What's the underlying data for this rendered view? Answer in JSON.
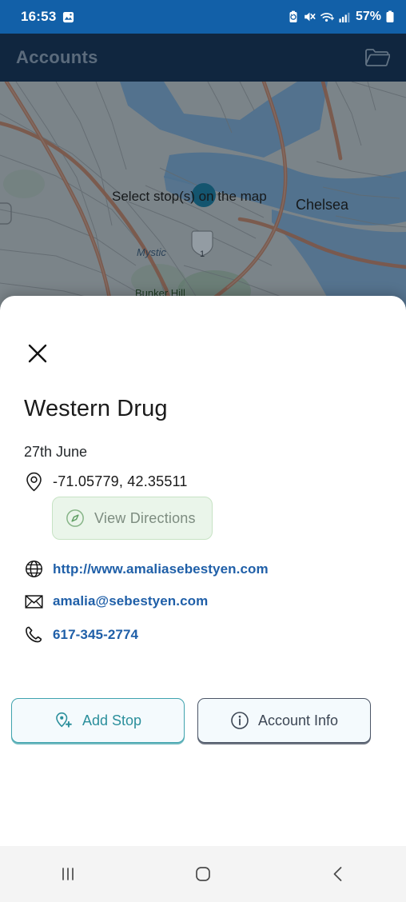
{
  "status_bar": {
    "clock": "16:53",
    "battery_percent": "57%",
    "icons": [
      "image-icon",
      "power-save-icon",
      "mute-icon",
      "wifi-icon",
      "signal-icon",
      "battery-icon"
    ]
  },
  "header": {
    "title": "Accounts",
    "folder_icon": "folder-icon"
  },
  "map": {
    "instruction": "Select stop(s) on the map",
    "labels": [
      {
        "name": "Chelsea"
      },
      {
        "name": "Mystic"
      },
      {
        "name": "Bunker Hill"
      }
    ],
    "marker_color": "#14556f",
    "water_color": "#6d9fc4",
    "land_color": "#c9c8c0",
    "road_color": "#c97b52"
  },
  "sheet": {
    "close_icon": "close-icon",
    "business_name": "Western Drug",
    "date": "27th June",
    "coordinates": "-71.05779, 42.35511",
    "coords_icon": "location-pin-icon",
    "directions": {
      "label": "View Directions",
      "icon": "compass-icon",
      "bg_color": "#eaf5ea",
      "text_color": "#7d8c80"
    },
    "contacts": [
      {
        "icon": "globe-icon",
        "value": "http://www.amaliasebestyen.com"
      },
      {
        "icon": "envelope-icon",
        "value": "amalia@sebestyen.com"
      },
      {
        "icon": "phone-icon",
        "value": "617-345-2774"
      }
    ],
    "link_color": "#1f5fa8",
    "actions": [
      {
        "label": "Add Stop",
        "icon": "pin-plus-icon",
        "accent": "#2b8f9c"
      },
      {
        "label": "Account Info",
        "icon": "info-icon",
        "accent": "#3c4654"
      }
    ]
  },
  "nav_bar": {
    "recents_icon": "recents-icon",
    "home_icon": "home-icon",
    "back_icon": "back-icon"
  }
}
